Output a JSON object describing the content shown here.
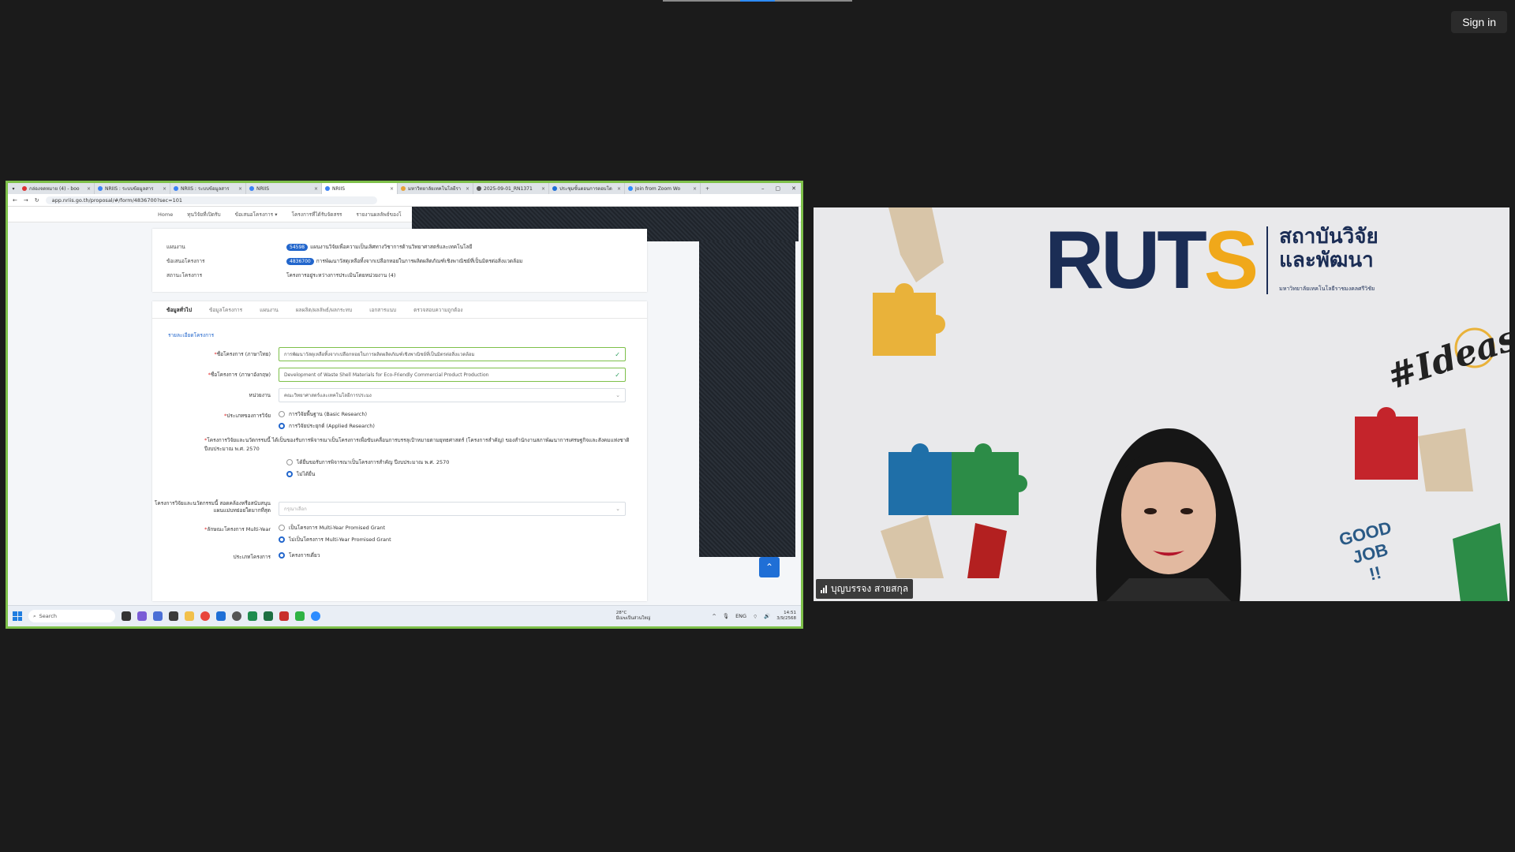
{
  "meeting": {
    "sign_in_label": "Sign in",
    "participant_name": "บุญบรรจง สายสกุล"
  },
  "browser": {
    "tabs": [
      {
        "label": "กล่องจดหมาย (4) - boo"
      },
      {
        "label": "NRIIS : ระบบข้อมูลสาร"
      },
      {
        "label": "NRIIS : ระบบข้อมูลสาร"
      },
      {
        "label": "NRIIS"
      },
      {
        "label": "NRIIS"
      },
      {
        "label": "มหาวิทยาลัยเทคโนโลยีรา"
      },
      {
        "label": "2025-09-01_RN1371"
      },
      {
        "label": "ประชุมขั้นตอนการตอบโต"
      },
      {
        "label": "Join from Zoom Wo"
      }
    ],
    "url": "app.nriis.go.th/proposal/#/form/4836700?sec=101"
  },
  "site_nav": {
    "items": [
      "Home",
      "ทุนวิจัยที่เปิดรับ",
      "ข้อเสนอโครงการ ▾",
      "โครงการที่ได้รับจัดสรร",
      "รายงานผลลัพธ์ของโ"
    ]
  },
  "info": {
    "rows": [
      {
        "label": "แผนงาน",
        "badge": "54598",
        "value": "แผนงานวิจัยเพื่อความเป็นเลิศทางวิชาการด้านวิทยาศาสตร์และเทคโนโลยี"
      },
      {
        "label": "ข้อเสนอโครงการ",
        "badge": "4836700",
        "value": "การพัฒนาวัสดุเหลือทิ้งจากเปลือกหอยในการผลิตผลิตภัณฑ์เชิงพาณิชย์ที่เป็นมิตรต่อสิ่งแวดล้อม"
      },
      {
        "label": "สถานะโครงการ",
        "badge": "",
        "value": "โครงการอยู่ระหว่างการประเมินโดยหน่วยงาน (4)"
      }
    ]
  },
  "form": {
    "tabs": [
      "ข้อมูลทั่วไป",
      "ข้อมูลโครงการ",
      "แผนงาน",
      "ผลผลิต/ผลลัพธ์/ผลกระทบ",
      "เอกสารแนบ",
      "ตรวจสอบความถูกต้อง"
    ],
    "section_title": "รายละเอียดโครงการ",
    "name_th_label": "ชื่อโครงการ (ภาษาไทย)",
    "name_th_value": "การพัฒนาวัสดุเหลือทิ้งจากเปลือกหอยในการผลิตผลิตภัณฑ์เชิงพาณิชย์ที่เป็นมิตรต่อสิ่งแวดล้อม",
    "name_en_label": "ชื่อโครงการ (ภาษาอังกฤษ)",
    "name_en_value": "Development of Waste Shell Materials for Eco-Friendly Commercial Product Production",
    "unit_label": "หน่วยงาน",
    "unit_value": "คณะวิทยาศาสตร์และเทคโนโลยีการประมง",
    "research_type_label": "ประเภทของการวิจัย",
    "research_type_opt1": "การวิจัยพื้นฐาน (Basic Research)",
    "research_type_opt2": "การวิจัยประยุกต์ (Applied Research)",
    "flagship_question": "โครงการวิจัยและนวัตกรรมนี้ ได้เป็นของรับการพิจารณาเป็นโครงการเพื่อขับเคลื่อนการบรรลุเป้าหมายตามยุทธศาสตร์ (โครงการสำคัญ) ของสำนักงานสภาพัฒนาการเศรษฐกิจและสังคมแห่งชาติ ปีงบประมาณ พ.ศ. 2570",
    "flagship_opt1": "ได้ยื่นขอรับการพิจารณาเป็นโครงการสำคัญ ปีงบประมาณ พ.ศ. 2570",
    "flagship_opt2": "ไม่ได้ยื่น",
    "support_label": "โครงการวิจัยและนวัตกรรมนี้ สอดคล้องหรือสนับสนุนแผนแม่บทย่อยใดมากที่สุด",
    "support_placeholder": "กรุณาเลือก",
    "multi_year_label": "ลักษณะโครงการ Multi-Year",
    "multi_year_opt1": "เป็นโครงการ Multi-Year Promised Grant",
    "multi_year_opt2": "ไม่เป็นโครงการ Multi-Year Promised Grant",
    "project_type_label": "ประเภทโครงการ",
    "project_type_opt1": "โครงการเดี่ยว"
  },
  "taskbar": {
    "search_label": "Search",
    "weather_temp": "28°C",
    "weather_desc": "มีเมฆเป็นส่วนใหญ่",
    "lang": "ENG",
    "time": "14:51",
    "date": "3/9/2568"
  },
  "camera_bg": {
    "logo_text_main": "RUT",
    "logo_text_s": "S",
    "logo_th_line1": "สถาบันวิจัย",
    "logo_th_line2": "และพัฒนา",
    "logo_th_sub": "มหาวิทยาลัยเทคโนโลยีราชมงคลศรีวิชัย",
    "ideas_text": "#Ideas",
    "goodjob_line1": "GOOD",
    "goodjob_line2": "JOB",
    "goodjob_line3": "!!"
  },
  "colors": {
    "share_border": "#7ec04a",
    "brand_blue": "#2266cc",
    "ruts_navy": "#1b2d55",
    "ruts_orange": "#f0a81a"
  }
}
